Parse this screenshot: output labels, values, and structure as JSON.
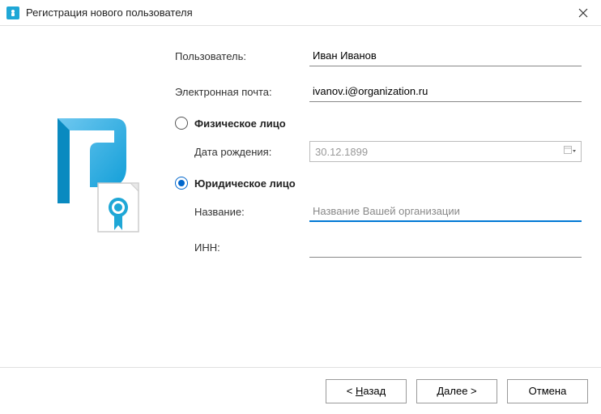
{
  "window": {
    "title": "Регистрация нового пользователя"
  },
  "form": {
    "user_label": "Пользователь:",
    "user_value": "Иван Иванов",
    "email_label": "Электронная почта:",
    "email_value": "ivanov.i@organization.ru",
    "person_radio": "Физическое лицо",
    "birthdate_label": "Дата рождения:",
    "birthdate_value": "30.12.1899",
    "legal_radio": "Юридическое лицо",
    "org_label": "Название:",
    "org_value": "Название Вашей организации",
    "inn_label": "ИНН:",
    "inn_value": ""
  },
  "buttons": {
    "back_prefix": "< ",
    "back_u": "Н",
    "back_rest": "азад",
    "next_u": "Д",
    "next_rest": "алее >",
    "cancel": "Отмена"
  }
}
